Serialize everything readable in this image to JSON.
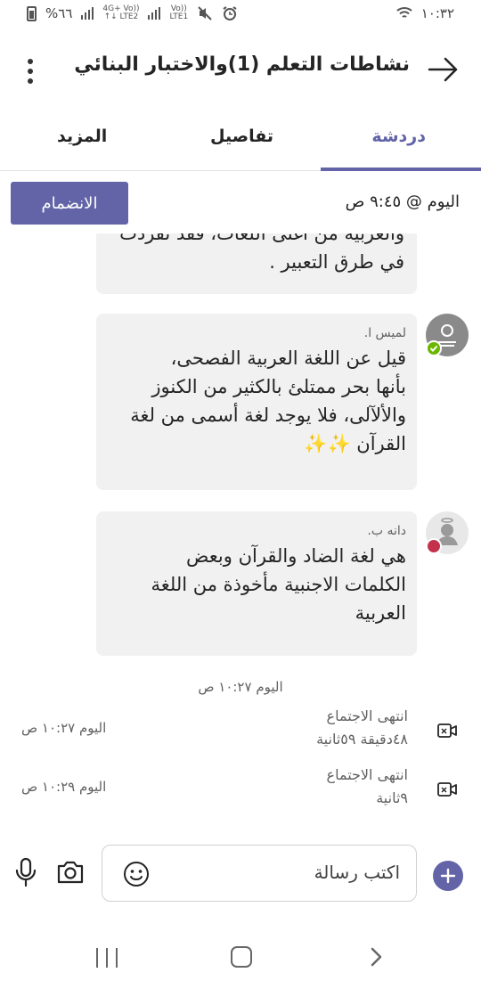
{
  "status_bar": {
    "time": "١٠:٣٢",
    "battery": "%٦٦",
    "network_1": "4G+ Vo)) LTE2",
    "network_2": "Vo)) LTE1"
  },
  "header": {
    "title": "نشاطات التعلم (1)والاختبار البنائي"
  },
  "tabs": [
    {
      "label": "دردشة",
      "active": true
    },
    {
      "label": "تفاصيل",
      "active": false
    },
    {
      "label": "المزيد",
      "active": false
    }
  ],
  "meeting": {
    "time_label": "اليوم @ ٩:٤٥ ص",
    "join_label": "الانضمام"
  },
  "messages": [
    {
      "author": "",
      "lines": [
        "والعربية من أغنى اللغات، فقد تفردت",
        "في طرق التعبير ."
      ]
    },
    {
      "author": "لميس ا.",
      "lines": [
        "قيل عن اللغة العربية الفصحى،",
        "بأنها بحر ممتلئ بالكثير من الكنوز",
        "والألآلى، فلا يوجد لغة أسمى من لغة",
        "القرآن ✨✨"
      ],
      "status": "available"
    },
    {
      "author": "دانه ب.",
      "lines": [
        "هي لغة الضاد والقرآن وبعض",
        "الكلمات الاجنبية مأخوذة من اللغة",
        "العربية"
      ],
      "status": "busy"
    }
  ],
  "date_separator": "اليوم ١٠:٢٧ ص",
  "events": [
    {
      "title": "انتهى الاجتماع",
      "duration": "٤٨دقيقة ٥٩ثانية",
      "time": "اليوم ١٠:٢٧ ص"
    },
    {
      "title": "انتهى الاجتماع",
      "duration": "٩ثانية",
      "time": "اليوم ١٠:٢٩ ص"
    }
  ],
  "composer": {
    "placeholder": "اكتب رسالة"
  },
  "colors": {
    "accent": "#6264a7",
    "bubble": "#f1f1f1",
    "available": "#6bb700",
    "busy": "#c4314b"
  }
}
